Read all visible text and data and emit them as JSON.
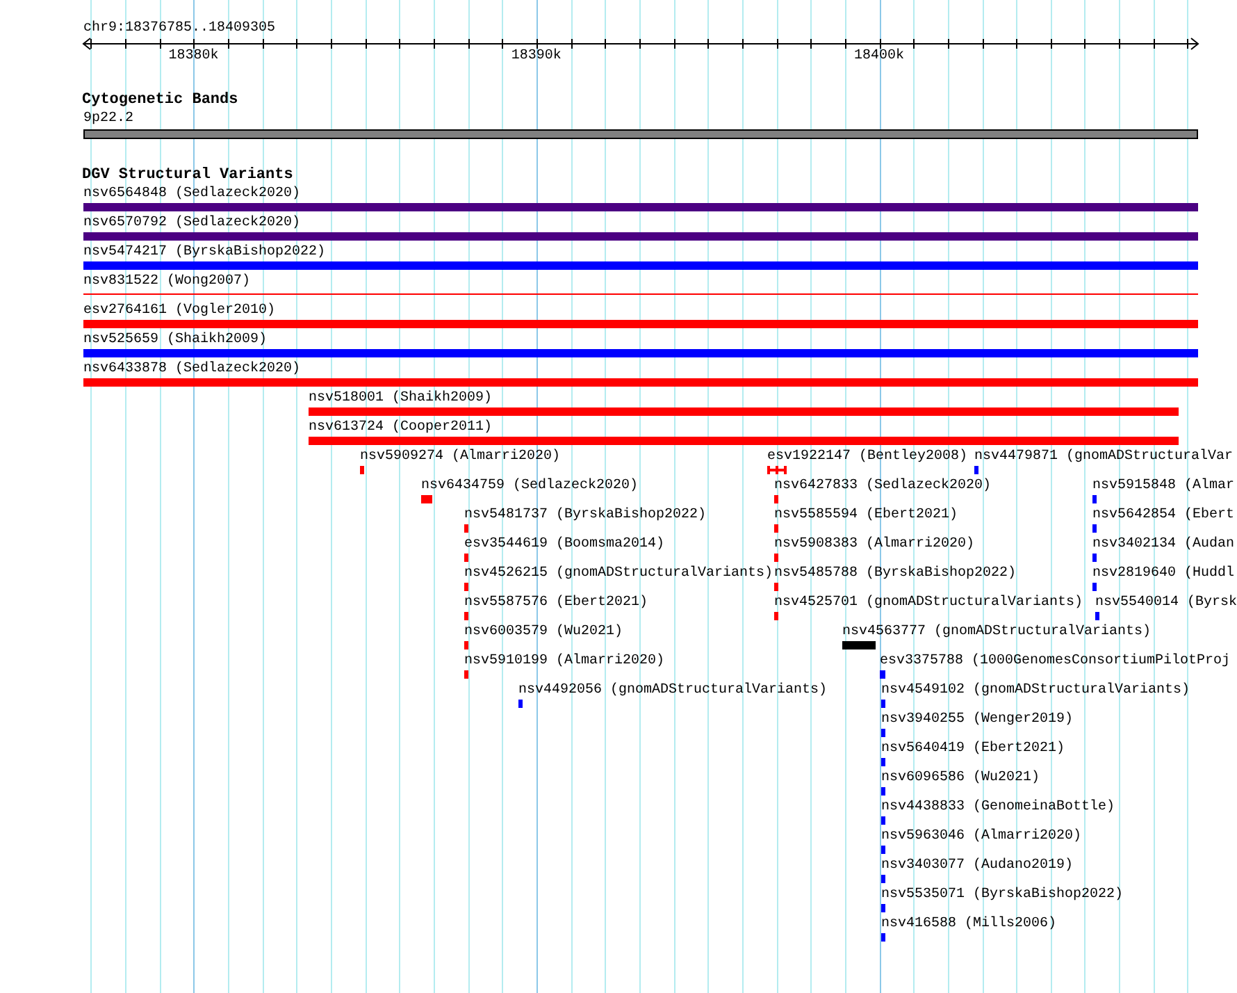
{
  "ruler": {
    "location": "chr9:18376785..18409305",
    "labels": [
      "18380k",
      "18390k",
      "18400k"
    ]
  },
  "cytoband_track": {
    "title": "Cytogenetic Bands",
    "band": "9p22.2"
  },
  "variant_track": {
    "title": "DGV Structural Variants",
    "lanes": [
      {
        "features": [
          {
            "label": "nsv6564848 (Sedlazeck2020)",
            "kind": "bar",
            "color": "#4b0082"
          }
        ]
      },
      {
        "features": [
          {
            "label": "nsv6570792 (Sedlazeck2020)",
            "kind": "bar",
            "color": "#4b0082"
          }
        ]
      },
      {
        "features": [
          {
            "label": "nsv5474217 (ByrskaBishop2022)",
            "kind": "bar",
            "color": "#0000ff"
          }
        ]
      },
      {
        "features": [
          {
            "label": "nsv831522 (Wong2007)",
            "kind": "line",
            "color": "#ff0000"
          }
        ]
      },
      {
        "features": [
          {
            "label": "esv2764161 (Vogler2010)",
            "kind": "bar",
            "color": "#ff0000"
          }
        ]
      },
      {
        "features": [
          {
            "label": "nsv525659 (Shaikh2009)",
            "kind": "bar",
            "color": "#0000ff"
          }
        ]
      },
      {
        "features": [
          {
            "label": "nsv6433878 (Sedlazeck2020)",
            "kind": "bar",
            "color": "#ff0000"
          }
        ]
      },
      {
        "features": [
          {
            "label": "nsv518001 (Shaikh2009)",
            "kind": "bar",
            "color": "#ff0000"
          }
        ]
      },
      {
        "features": [
          {
            "label": "nsv613724 (Cooper2011)",
            "kind": "bar",
            "color": "#ff0000"
          }
        ]
      },
      {
        "features": [
          {
            "label": "nsv5909274 (Almarri2020)",
            "kind": "bar",
            "color": "#ff0000"
          },
          {
            "label": "esv1922147 (Bentley2008)",
            "kind": "interval",
            "color": "#ff0000"
          },
          {
            "label": "nsv4479871 (gnomADStructuralVar",
            "kind": "bar",
            "color": "#0000ff"
          }
        ]
      },
      {
        "features": [
          {
            "label": "nsv6434759 (Sedlazeck2020)",
            "kind": "bar",
            "color": "#ff0000"
          },
          {
            "label": "nsv6427833 (Sedlazeck2020)",
            "kind": "bar",
            "color": "#ff0000"
          },
          {
            "label": "nsv5915848 (Almar",
            "kind": "bar",
            "color": "#0000ff"
          }
        ]
      },
      {
        "features": [
          {
            "label": "nsv5481737 (ByrskaBishop2022)",
            "kind": "bar",
            "color": "#ff0000"
          },
          {
            "label": "nsv5585594 (Ebert2021)",
            "kind": "bar",
            "color": "#ff0000"
          },
          {
            "label": "nsv5642854 (Ebert",
            "kind": "bar",
            "color": "#0000ff"
          }
        ]
      },
      {
        "features": [
          {
            "label": "esv3544619 (Boomsma2014)",
            "kind": "bar",
            "color": "#ff0000"
          },
          {
            "label": "nsv5908383 (Almarri2020)",
            "kind": "bar",
            "color": "#ff0000"
          },
          {
            "label": "nsv3402134 (Audan",
            "kind": "bar",
            "color": "#0000ff"
          }
        ]
      },
      {
        "features": [
          {
            "label": "nsv4526215 (gnomADStructuralVariants)",
            "kind": "bar",
            "color": "#ff0000"
          },
          {
            "label": "nsv5485788 (ByrskaBishop2022)",
            "kind": "bar",
            "color": "#ff0000"
          },
          {
            "label": "nsv2819640 (Huddl",
            "kind": "bar",
            "color": "#0000ff"
          }
        ]
      },
      {
        "features": [
          {
            "label": "nsv5587576 (Ebert2021)",
            "kind": "bar",
            "color": "#ff0000"
          },
          {
            "label": "nsv4525701 (gnomADStructuralVariants)",
            "kind": "bar",
            "color": "#ff0000"
          },
          {
            "label": "nsv5540014 (Byrsk",
            "kind": "bar",
            "color": "#0000ff"
          }
        ]
      },
      {
        "features": [
          {
            "label": "nsv6003579 (Wu2021)",
            "kind": "bar",
            "color": "#ff0000"
          },
          {
            "label": "nsv4563777 (gnomADStructuralVariants)",
            "kind": "bar",
            "color": "#000000"
          }
        ]
      },
      {
        "features": [
          {
            "label": "nsv5910199 (Almarri2020)",
            "kind": "bar",
            "color": "#ff0000"
          },
          {
            "label": "esv3375788 (1000GenomesConsortiumPilotProj",
            "kind": "bar",
            "color": "#0000ff"
          }
        ]
      },
      {
        "features": [
          {
            "label": "nsv4492056 (gnomADStructuralVariants)",
            "kind": "bar",
            "color": "#0000ff"
          },
          {
            "label": "nsv4549102 (gnomADStructuralVariants)",
            "kind": "bar",
            "color": "#0000ff"
          }
        ]
      },
      {
        "features": [
          {
            "label": "nsv3940255 (Wenger2019)",
            "kind": "bar",
            "color": "#0000ff"
          }
        ]
      },
      {
        "features": [
          {
            "label": "nsv5640419 (Ebert2021)",
            "kind": "bar",
            "color": "#0000ff"
          }
        ]
      },
      {
        "features": [
          {
            "label": "nsv6096586 (Wu2021)",
            "kind": "bar",
            "color": "#0000ff"
          }
        ]
      },
      {
        "features": [
          {
            "label": "nsv4438833 (GenomeinaBottle)",
            "kind": "bar",
            "color": "#0000ff"
          }
        ]
      },
      {
        "features": [
          {
            "label": "nsv5963046 (Almarri2020)",
            "kind": "bar",
            "color": "#0000ff"
          }
        ]
      },
      {
        "features": [
          {
            "label": "nsv3403077 (Audano2019)",
            "kind": "bar",
            "color": "#0000ff"
          }
        ]
      },
      {
        "features": [
          {
            "label": "nsv5535071 (ByrskaBishop2022)",
            "kind": "bar",
            "color": "#0000ff"
          }
        ]
      },
      {
        "features": [
          {
            "label": "nsv416588 (Mills2006)",
            "kind": "bar",
            "color": "#0000ff"
          }
        ]
      }
    ]
  }
}
